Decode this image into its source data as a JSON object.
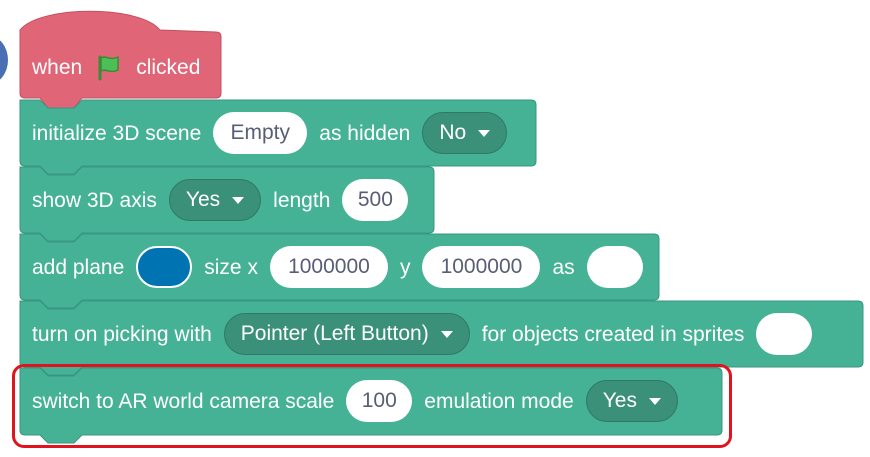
{
  "colors": {
    "hat": "#e06677",
    "block": "#46b295",
    "dropdown": "#3a9078",
    "highlight": "#e0141e",
    "plane_color": "#0073b3"
  },
  "hat": {
    "when": "when",
    "flag_icon": "green-flag-icon",
    "clicked": "clicked"
  },
  "blocks": {
    "init": {
      "label": "initialize 3D scene",
      "value": "Empty",
      "mid": "as hidden",
      "dropdown": "No"
    },
    "axis": {
      "label": "show 3D axis",
      "dropdown": "Yes",
      "mid": "length",
      "value": "500"
    },
    "plane": {
      "label": "add plane",
      "size_x_label": "size x",
      "x_value": "1000000",
      "y_label": "y",
      "y_value": "1000000",
      "as_label": "as",
      "as_value": ""
    },
    "picking": {
      "label": "turn on picking with",
      "dropdown": "Pointer (Left Button)",
      "suffix": "for objects created in sprites",
      "value": ""
    },
    "ar": {
      "label": "switch to AR world camera scale",
      "value": "100",
      "mid": "emulation mode",
      "dropdown": "Yes"
    }
  }
}
